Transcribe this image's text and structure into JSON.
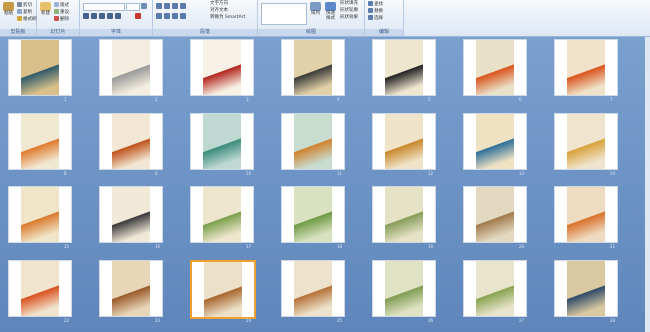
{
  "ribbon": {
    "groups": [
      {
        "label": "剪贴板",
        "buttons": [
          "粘贴",
          "剪切",
          "复制",
          "格式刷"
        ]
      },
      {
        "label": "幻灯片",
        "buttons": [
          "新建",
          "幻灯片",
          "版式",
          "重设",
          "删除"
        ]
      },
      {
        "label": "字体",
        "buttons": []
      },
      {
        "label": "段落",
        "buttons": [
          "文字方向",
          "对齐文本",
          "转换为 SmartArt"
        ]
      },
      {
        "label": "绘图",
        "buttons": [
          "排列",
          "快速样式",
          "形状填充",
          "形状轮廓",
          "形状效果"
        ]
      },
      {
        "label": "编辑",
        "buttons": [
          "查找",
          "替换",
          "选择"
        ]
      }
    ]
  },
  "slides": [
    {
      "n": "1",
      "bg": "#d9c08a",
      "accent": "#2e5a6a"
    },
    {
      "n": "2",
      "bg": "#f4eee0",
      "accent": "#999999"
    },
    {
      "n": "3",
      "bg": "#f6f1e4",
      "accent": "#b3261e"
    },
    {
      "n": "4",
      "bg": "#e2d1a8",
      "accent": "#3a3a3a"
    },
    {
      "n": "5",
      "bg": "#efe6cf",
      "accent": "#222222"
    },
    {
      "n": "6",
      "bg": "#e9e0c8",
      "accent": "#d9541d"
    },
    {
      "n": "7",
      "bg": "#efe2c8",
      "accent": "#d9541d"
    },
    {
      "n": "8",
      "bg": "#f1e8d2",
      "accent": "#e07a2e"
    },
    {
      "n": "9",
      "bg": "#f1e7d4",
      "accent": "#c0521a"
    },
    {
      "n": "10",
      "bg": "#bfd9d2",
      "accent": "#3b8c7a"
    },
    {
      "n": "11",
      "bg": "#c8ddd0",
      "accent": "#d0822e"
    },
    {
      "n": "12",
      "bg": "#efe4c9",
      "accent": "#c9882c"
    },
    {
      "n": "13",
      "bg": "#efe2c2",
      "accent": "#2d6f9b"
    },
    {
      "n": "14",
      "bg": "#efe4cd",
      "accent": "#d9a23a"
    },
    {
      "n": "15",
      "bg": "#f0e5c8",
      "accent": "#d97a2c"
    },
    {
      "n": "16",
      "bg": "#f0e9d8",
      "accent": "#3a3a3a"
    },
    {
      "n": "17",
      "bg": "#eee5cd",
      "accent": "#7aa04a"
    },
    {
      "n": "18",
      "bg": "#d8e2c0",
      "accent": "#6f9a45"
    },
    {
      "n": "19",
      "bg": "#e6e2c6",
      "accent": "#879d5a"
    },
    {
      "n": "20",
      "bg": "#e3d9c1",
      "accent": "#a07a4c"
    },
    {
      "n": "21",
      "bg": "#eedcc2",
      "accent": "#d9702a"
    },
    {
      "n": "22",
      "bg": "#f1e4cd",
      "accent": "#d9501e"
    },
    {
      "n": "23",
      "bg": "#e7d6b8",
      "accent": "#9a5a2a"
    },
    {
      "n": "24",
      "bg": "#ece0c8",
      "accent": "#a8662d"
    },
    {
      "n": "25",
      "bg": "#ede3cc",
      "accent": "#b57238"
    },
    {
      "n": "26",
      "bg": "#dfe3c4",
      "accent": "#809c52"
    },
    {
      "n": "27",
      "bg": "#e9e4cc",
      "accent": "#88a350"
    },
    {
      "n": "28",
      "bg": "#d9c8a0",
      "accent": "#2e4a6a"
    }
  ],
  "colors": {
    "ribbon_bg": "#eef3fa",
    "sorter_bg": "#6f95c6",
    "selection": "#f0a030"
  }
}
